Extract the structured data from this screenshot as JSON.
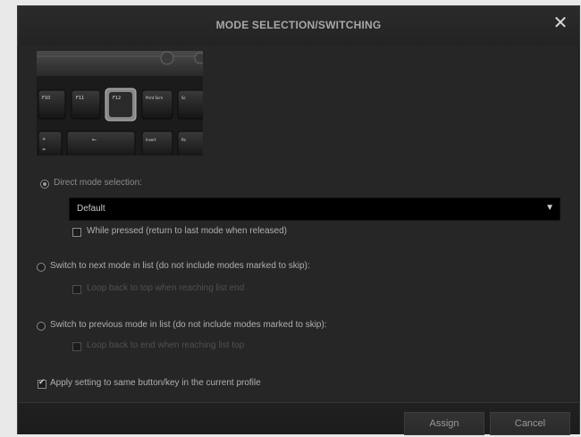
{
  "dialog": {
    "title": "MODE SELECTION/SWITCHING",
    "close_icon": "close-icon"
  },
  "keyboard": {
    "keys": [
      "F10",
      "F11",
      "F12",
      "Print Scrn",
      "Sc",
      "Insert",
      "Pa"
    ]
  },
  "options": {
    "direct": {
      "label": "Direct mode selection:",
      "selected": true
    },
    "dropdown": {
      "value": "Default"
    },
    "while_pressed": {
      "label": "While pressed (return to last mode when released)",
      "checked": false
    },
    "next": {
      "label": "Switch to next mode in list (do not include modes marked to skip):",
      "selected": false
    },
    "loop_top": {
      "label": "Loop back to top when reaching list end",
      "checked": false,
      "enabled": false
    },
    "previous": {
      "label": "Switch to previous mode in list (do not include modes marked to skip):",
      "selected": false
    },
    "loop_end": {
      "label": "Loop back to end when reaching list top",
      "checked": false,
      "enabled": false
    },
    "apply_same": {
      "label": "Apply setting to same button/key in the current profile",
      "checked": true
    }
  },
  "buttons": {
    "assign": "Assign",
    "cancel": "Cancel"
  },
  "colors": {
    "dialog_bg": "#262626",
    "text": "#b0b0b0",
    "disabled_text": "#505050",
    "dropdown_bg": "#000000"
  }
}
